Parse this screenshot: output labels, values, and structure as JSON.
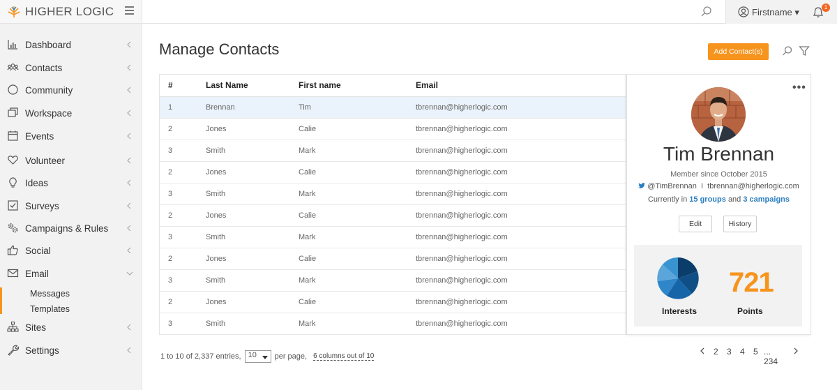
{
  "brand": {
    "name": "HIGHER LOGIC"
  },
  "sidebar": {
    "items": [
      {
        "label": "Dashboard",
        "icon": "bar-chart-icon"
      },
      {
        "label": "Contacts",
        "icon": "people-icon"
      },
      {
        "label": "Community",
        "icon": "circle-icon"
      },
      {
        "label": "Workspace",
        "icon": "windows-icon"
      },
      {
        "label": "Events",
        "icon": "calendar-icon"
      },
      {
        "label": "Volunteer",
        "icon": "heart-icon"
      },
      {
        "label": "Ideas",
        "icon": "lightbulb-icon"
      },
      {
        "label": "Surveys",
        "icon": "checkbox-icon"
      },
      {
        "label": "Campaigns & Rules",
        "icon": "gears-icon"
      },
      {
        "label": "Social",
        "icon": "thumbs-up-icon"
      },
      {
        "label": "Email",
        "icon": "envelope-icon"
      },
      {
        "label": "Sites",
        "icon": "sitemap-icon"
      },
      {
        "label": "Settings",
        "icon": "wrench-icon"
      }
    ],
    "email_sub": [
      "Messages",
      "Templates"
    ]
  },
  "header": {
    "user_name": "Firstname ▾",
    "notification_count": "1"
  },
  "main": {
    "title": "Manage Contacts",
    "add_button": "Add Contact(s)"
  },
  "table": {
    "columns": [
      "#",
      "Last Name",
      "First name",
      "Email"
    ],
    "rows": [
      [
        "1",
        "Brennan",
        "Tim",
        "tbrennan@higherlogic.com"
      ],
      [
        "2",
        "Jones",
        "Calie",
        "tbrennan@higherlogic.com"
      ],
      [
        "3",
        "Smith",
        "Mark",
        "tbrennan@higherlogic.com"
      ],
      [
        "2",
        "Jones",
        "Calie",
        "tbrennan@higherlogic.com"
      ],
      [
        "3",
        "Smith",
        "Mark",
        "tbrennan@higherlogic.com"
      ],
      [
        "2",
        "Jones",
        "Calie",
        "tbrennan@higherlogic.com"
      ],
      [
        "3",
        "Smith",
        "Mark",
        "tbrennan@higherlogic.com"
      ],
      [
        "2",
        "Jones",
        "Calie",
        "tbrennan@higherlogic.com"
      ],
      [
        "3",
        "Smith",
        "Mark",
        "tbrennan@higherlogic.com"
      ],
      [
        "2",
        "Jones",
        "Calie",
        "tbrennan@higherlogic.com"
      ],
      [
        "3",
        "Smith",
        "Mark",
        "tbrennan@higherlogic.com"
      ]
    ],
    "selected_row": 0
  },
  "profile": {
    "name": "Tim Brennan",
    "member_since": "Member since October 2015",
    "twitter": "@TimBrennan",
    "separator": "I",
    "email": "tbrennan@higherlogic.com",
    "current_prefix": "Currently in",
    "groups": "15 groups",
    "current_and": "and",
    "campaigns": "3 campaigns",
    "edit_label": "Edit",
    "history_label": "History",
    "interests_label": "Interests",
    "points_value": "721",
    "points_label": "Points",
    "interest_colors": [
      "#0b3d6b",
      "#1565a8",
      "#2f86c8",
      "#5aa5da",
      "#0f4f86",
      "#3a93d1"
    ]
  },
  "footer": {
    "entries_text": "1 to 10 of 2,337 entries,",
    "per_page_value": "10",
    "per_page_text": "per page,",
    "columns_text": "6 columns out of 10",
    "pages": [
      "2",
      "3",
      "4",
      "5",
      "... 234"
    ]
  },
  "colors": {
    "accent": "#f7941d",
    "link": "#2a7fc1",
    "selected_row": "#eaf3fb"
  }
}
